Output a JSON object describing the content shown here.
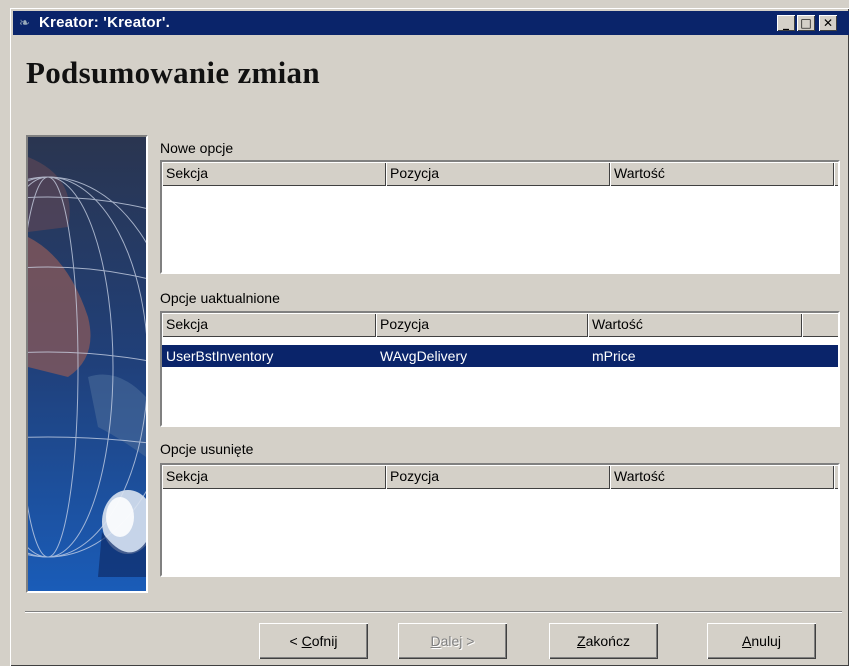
{
  "window": {
    "title": "Kreator: 'Kreator'.",
    "icon": "wizard-icon",
    "controls": [
      "minimize-icon",
      "maximize-icon",
      "close-icon"
    ]
  },
  "heading": "Podsumowanie zmian",
  "sections": {
    "new": {
      "label": "Nowe opcje",
      "columns": [
        "Sekcja",
        "Pozycja",
        "Wartość"
      ],
      "rows": []
    },
    "updated": {
      "label": "Opcje uaktualnione",
      "columns": [
        "Sekcja",
        "Pozycja",
        "Wartość"
      ],
      "rows": [
        {
          "section": "UserBstInventory",
          "item": "WAvgDelivery",
          "value": "mPrice",
          "selected": true
        }
      ]
    },
    "removed": {
      "label": "Opcje usunięte",
      "columns": [
        "Sekcja",
        "Pozycja",
        "Wartość"
      ],
      "rows": []
    }
  },
  "buttons": {
    "back": {
      "prefix": "< ",
      "accel": "C",
      "rest": "ofnij"
    },
    "next": {
      "accel": "D",
      "rest": "alej",
      "suffix": " >",
      "enabled": false
    },
    "finish": {
      "accel": "Z",
      "rest": "akończ"
    },
    "cancel": {
      "accel": "A",
      "rest": "nuluj"
    }
  },
  "colors": {
    "titlebar": "#0a246a",
    "selection": "#0a246a",
    "face": "#d4d0c8"
  }
}
